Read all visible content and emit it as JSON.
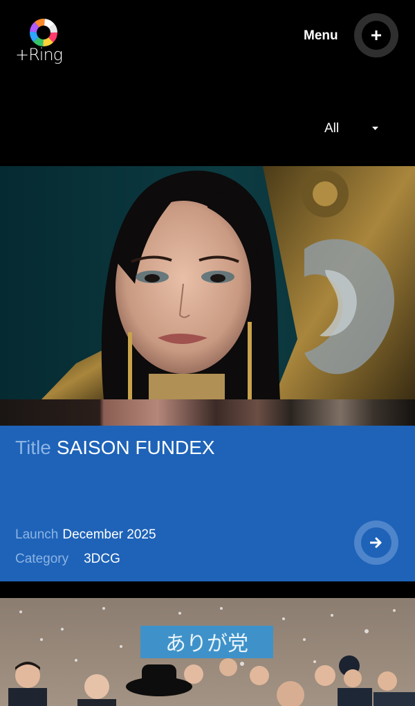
{
  "header": {
    "logo_text": "+Ring",
    "menu_label": "Menu"
  },
  "filter": {
    "selected": "All"
  },
  "works": [
    {
      "title_key": "Title",
      "title": "SAISON FUNDEX",
      "launch_key": "Launch",
      "launch": "December 2025",
      "category_key": "Category",
      "category": "3DCG"
    },
    {
      "sign_text": "ありが党"
    }
  ],
  "colors": {
    "background": "#000000",
    "panel_blue": "#1e63b8",
    "key_text": "#8db4e5"
  },
  "icons": {
    "menu": "plus-icon",
    "filter": "caret-down-icon",
    "open": "arrow-right-icon"
  }
}
